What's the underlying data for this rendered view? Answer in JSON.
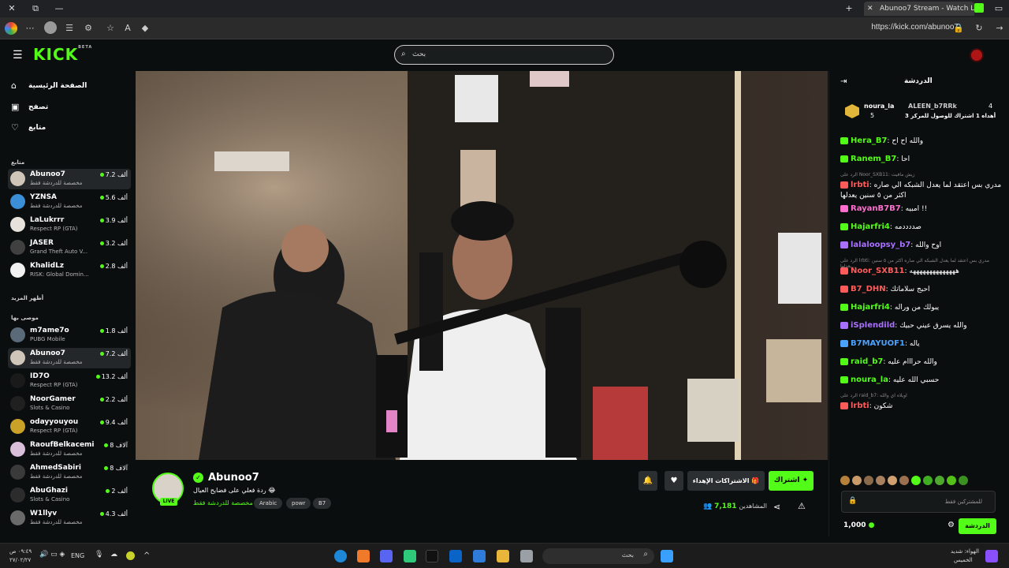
{
  "browser": {
    "tab_title": "Abunoo7 Stream - Watch Li",
    "url": "https://kick.com/abunoo7"
  },
  "header": {
    "logo": "KICK",
    "logo_badge": "BETA",
    "search_placeholder": "بحث"
  },
  "sidebar": {
    "nav": [
      {
        "label": "الصفحة الرئيسية",
        "icon": "home-icon"
      },
      {
        "label": "تصفح",
        "icon": "browse-icon"
      },
      {
        "label": "متابع",
        "icon": "heart-icon"
      }
    ],
    "following_heading": "متابع",
    "following": [
      {
        "name": "Abunoo7",
        "game": "مخصصة للدردشة فقط",
        "viewers": "7.2 ألف",
        "color": "#cfc5b8"
      },
      {
        "name": "YZNSA",
        "game": "مخصصة للدردشة فقط",
        "viewers": "5.6 ألف",
        "color": "#3a8fd6"
      },
      {
        "name": "LaLukrrr",
        "game": "Respect RP (GTA)",
        "viewers": "3.9 ألف",
        "color": "#e8e2dc"
      },
      {
        "name": "JASER",
        "game": "Grand Theft Auto V...",
        "viewers": "3.2 ألف",
        "color": "#404040"
      },
      {
        "name": "KhalidLz",
        "game": "RISK: Global Domin...",
        "viewers": "2.8 ألف",
        "color": "#f2f2f2"
      }
    ],
    "show_more": "أظهر المزيد",
    "recommended_heading": "موصى بها",
    "recommended": [
      {
        "name": "m7ame7o",
        "game": "PUBG Mobile",
        "viewers": "1.8 ألف",
        "color": "#5b6a78"
      },
      {
        "name": "Abunoo7",
        "game": "مخصصة للدردشة فقط",
        "viewers": "7.2 ألف",
        "color": "#cfc5b8"
      },
      {
        "name": "ID7O",
        "game": "Respect RP (GTA)",
        "viewers": "13.2 ألف",
        "color": "#1a1a1a"
      },
      {
        "name": "NoorGamer",
        "game": "Slots & Casino",
        "viewers": "2.2 ألف",
        "color": "#202020"
      },
      {
        "name": "odayyouyou",
        "game": "Respect RP (GTA)",
        "viewers": "9.4 ألف",
        "color": "#c9a227"
      },
      {
        "name": "RaoufBelkacemi",
        "game": "مخصصة للدردشة فقط",
        "viewers": "8 آلاف",
        "color": "#d9bfd9"
      },
      {
        "name": "AhmedSabiri",
        "game": "مخصصة للدردشة فقط",
        "viewers": "8 آلاف",
        "color": "#3a3a3a"
      },
      {
        "name": "AbuGhazi",
        "game": "Slots & Casino",
        "viewers": "2 ألف",
        "color": "#2c2c2c"
      },
      {
        "name": "W1llyv",
        "game": "مخصصة للدردشة فقط",
        "viewers": "4.3 ألف",
        "color": "#6a6a6a"
      }
    ]
  },
  "stream": {
    "streamer": "Abunoo7",
    "live": "LIVE",
    "title": "ردة فعلي على فضايح العيال 😂",
    "category": "مخصصة للدردشة فقط",
    "tags": [
      "Arabic",
      "powr",
      "B7"
    ],
    "subscribe": "اشتراك",
    "gift_subs": "الاشتراكات الإهداء",
    "viewers_label": "المشاهدين",
    "viewers_count": "7,181"
  },
  "chat": {
    "title": "الدردشة",
    "pinned": {
      "user_a": "noura_la",
      "user_a_count": "5",
      "user_b": "ALEEN_b7RRk",
      "count": "4",
      "text": "أهداه 1 اشتراك للوصول للمركز 3"
    },
    "messages": [
      {
        "user": "Hera_B7",
        "text": "والله اح اح",
        "color": "#53fc18"
      },
      {
        "user": "Ranem_B7",
        "text": "احا",
        "color": "#53fc18"
      },
      {
        "reply": "الرد على Noor_SXB11: زيش مافيت"
      },
      {
        "user": "lrbti",
        "text": "مدري بس اعتقد لما يعدل الشبكه الي صاره اكثر من ٥ سنين يعدلها",
        "color": "#ff5b5b"
      },
      {
        "user": "RayanB7B7",
        "text": "امبيه !!",
        "color": "#ff6ecf"
      },
      {
        "user": "Hajarfri4",
        "text": "صددددمه",
        "color": "#53fc18"
      },
      {
        "user": "lalaloopsy_b7",
        "text": "اوح والله",
        "color": "#a970ff"
      },
      {
        "reply": "الرد على lrbti: مدري بس اعتقد لما يعدل الشبكه الي صاره اكثر من ٥ سنين يعدلها..."
      },
      {
        "user": "Noor_SXB11",
        "text": "ههههههههههههههه",
        "color": "#ff5b5b"
      },
      {
        "user": "B7_DHN",
        "text": "احبج سلاماتك",
        "color": "#ff5b5b"
      },
      {
        "user": "Hajarfri4",
        "text": "يبولك من وراله",
        "color": "#53fc18"
      },
      {
        "user": "iSplendild",
        "text": "والله يسرق عيني حبيك",
        "color": "#a970ff"
      },
      {
        "user": "B7MAYUOF1",
        "text": "ياله",
        "color": "#4aa3ff"
      },
      {
        "user": "raid_b7",
        "text": "والله حرااام عليه",
        "color": "#53fc18"
      },
      {
        "user": "noura_la",
        "text": "حسبي الله عليه",
        "color": "#53fc18"
      },
      {
        "reply": "الرد على raid_b7: اويلاه اي والله"
      },
      {
        "user": "lrbti",
        "text": "شكون",
        "color": "#ff5b5b"
      }
    ],
    "input_placeholder": "للمشتركين فقط",
    "send": "الدردشة",
    "points": "1,000"
  },
  "taskbar": {
    "lang": "ENG",
    "time": "٠٩:٤٩ ص",
    "date": "٢٧/٠٢/٢٧",
    "weather_label": "الهواء: شديد",
    "weather_sub": "الخميس",
    "search": "بحث"
  }
}
